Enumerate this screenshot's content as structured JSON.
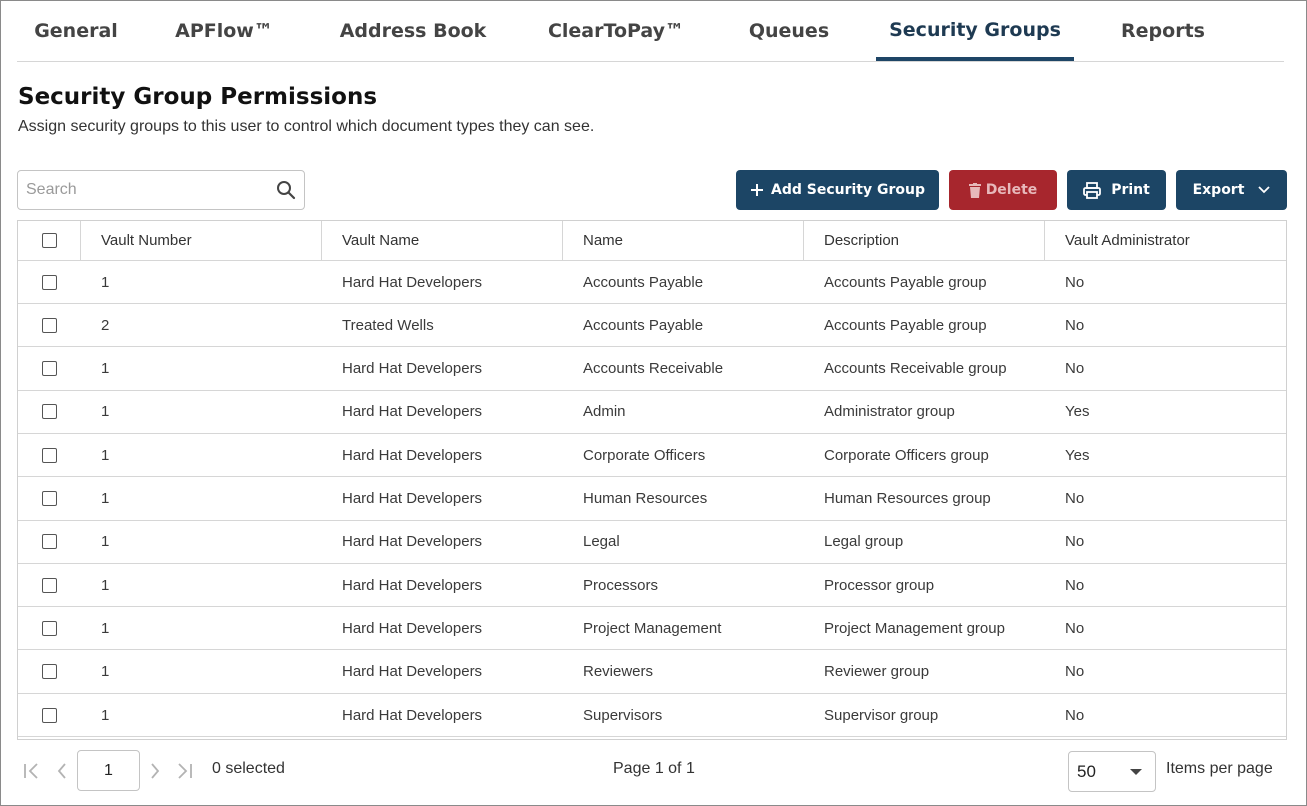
{
  "tabs": [
    {
      "label": "General"
    },
    {
      "label": "APFlow™"
    },
    {
      "label": "Address Book"
    },
    {
      "label": "ClearToPay™"
    },
    {
      "label": "Queues"
    },
    {
      "label": "Security Groups"
    },
    {
      "label": "Reports"
    }
  ],
  "active_tab": "Security Groups",
  "page": {
    "title": "Security Group Permissions",
    "subtitle": "Assign security groups to this user to control which document types they can see."
  },
  "search": {
    "placeholder": "Search",
    "value": ""
  },
  "toolbar": {
    "add_label": "Add Security Group",
    "delete_label": "Delete",
    "print_label": "Print",
    "export_label": "Export"
  },
  "table": {
    "columns": [
      "Vault Number",
      "Vault Name",
      "Name",
      "Description",
      "Vault Administrator"
    ],
    "rows": [
      {
        "vault_number": "1",
        "vault_name": "Hard Hat Developers",
        "name": "Accounts Payable",
        "description": "Accounts Payable group",
        "vault_admin": "No"
      },
      {
        "vault_number": "2",
        "vault_name": "Treated Wells",
        "name": "Accounts Payable",
        "description": "Accounts Payable group",
        "vault_admin": "No"
      },
      {
        "vault_number": "1",
        "vault_name": "Hard Hat Developers",
        "name": "Accounts Receivable",
        "description": "Accounts Receivable group",
        "vault_admin": "No"
      },
      {
        "vault_number": "1",
        "vault_name": "Hard Hat Developers",
        "name": "Admin",
        "description": "Administrator group",
        "vault_admin": "Yes"
      },
      {
        "vault_number": "1",
        "vault_name": "Hard Hat Developers",
        "name": "Corporate Officers",
        "description": "Corporate Officers group",
        "vault_admin": "Yes"
      },
      {
        "vault_number": "1",
        "vault_name": "Hard Hat Developers",
        "name": "Human Resources",
        "description": "Human Resources group",
        "vault_admin": "No"
      },
      {
        "vault_number": "1",
        "vault_name": "Hard Hat Developers",
        "name": "Legal",
        "description": "Legal group",
        "vault_admin": "No"
      },
      {
        "vault_number": "1",
        "vault_name": "Hard Hat Developers",
        "name": "Processors",
        "description": "Processor group",
        "vault_admin": "No"
      },
      {
        "vault_number": "1",
        "vault_name": "Hard Hat Developers",
        "name": "Project Management",
        "description": "Project Management group",
        "vault_admin": "No"
      },
      {
        "vault_number": "1",
        "vault_name": "Hard Hat Developers",
        "name": "Reviewers",
        "description": "Reviewer group",
        "vault_admin": "No"
      },
      {
        "vault_number": "1",
        "vault_name": "Hard Hat Developers",
        "name": "Supervisors",
        "description": "Supervisor group",
        "vault_admin": "No"
      }
    ]
  },
  "footer": {
    "current_page": "1",
    "selected_text": "0 selected",
    "page_text": "Page 1 of 1",
    "per_page_value": "50",
    "per_page_label": "Items per page"
  },
  "colors": {
    "primary": "#1c4565",
    "danger": "#a7262d",
    "active_tab_underline": "#1e4566"
  }
}
